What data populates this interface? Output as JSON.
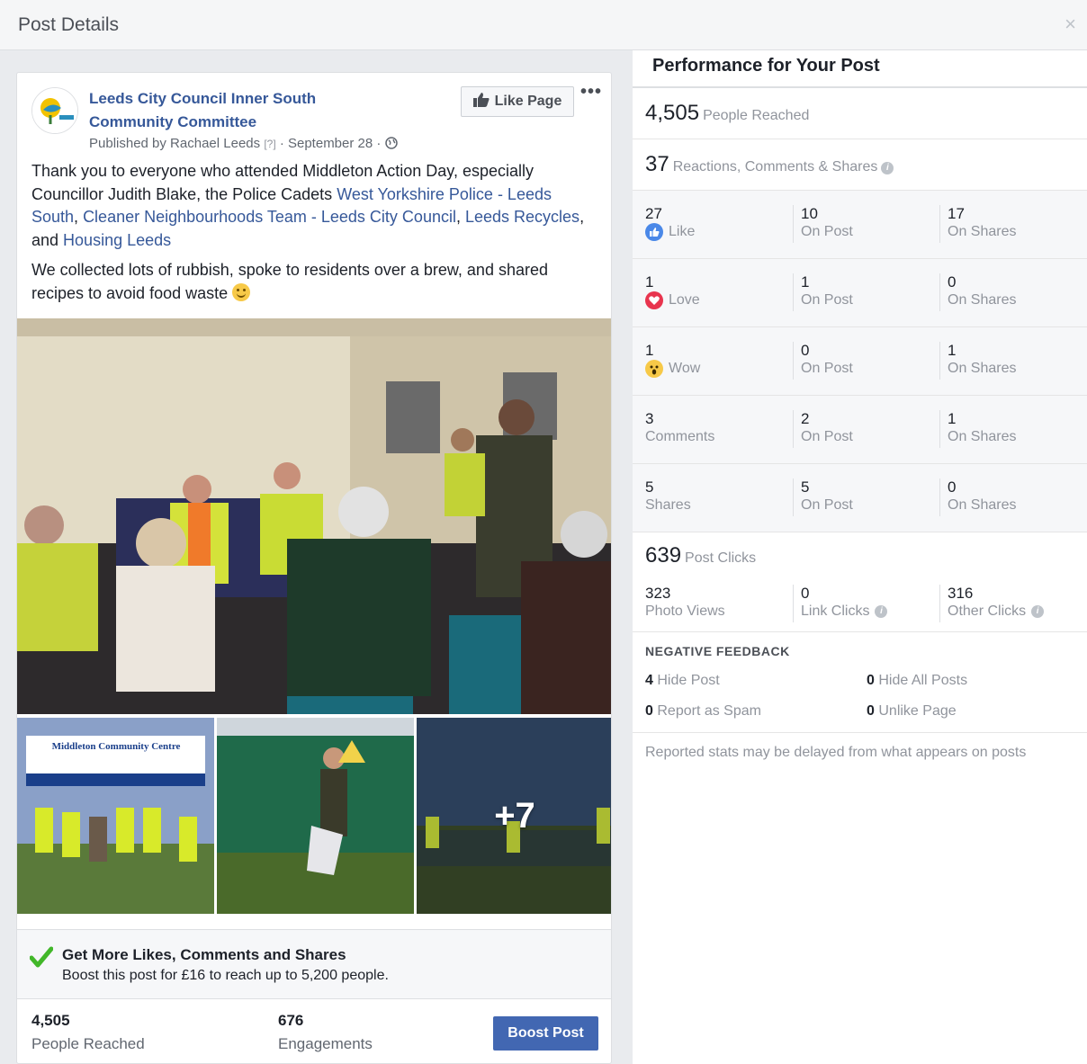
{
  "header": {
    "title": "Post Details",
    "close": "×"
  },
  "post": {
    "page_name": "Leeds City Council Inner South Community Committee",
    "meta_prefix": "Published by Rachael Leeds",
    "meta_q": "[?]",
    "meta_date": "· September 28 ·",
    "like_page": "Like Page",
    "more": "•••",
    "text_parts": {
      "p1": "Thank you to everyone who attended Middleton Action Day, especially Councillor Judith Blake, the Police Cadets ",
      "l1": "West Yorkshire Police - Leeds South",
      "s1": ", ",
      "l2": "Cleaner Neighbourhoods Team - Leeds City Council",
      "s2": ", ",
      "l3": "Leeds Recycles",
      "s3": ", and ",
      "l4": "Housing Leeds"
    },
    "text2": "We collected lots of rubbish, spoke to residents over a brew, and shared recipes to avoid food waste ",
    "thumb_sign": "Middleton Community Centre",
    "more_photos": "+7",
    "boost_title": "Get More Likes, Comments and Shares",
    "boost_sub": "Boost this post for £16 to reach up to 5,200 people.",
    "reached_num": "4,505",
    "reached_lbl": "People Reached",
    "eng_num": "676",
    "eng_lbl": "Engagements",
    "boost_btn": "Boost Post"
  },
  "performance": {
    "title": "Performance for Your Post",
    "reached_num": "4,505",
    "reached_lbl": "People Reached",
    "rcs_num": "37",
    "rcs_lbl": "Reactions, Comments & Shares",
    "info": "i",
    "rows": [
      {
        "n1": "27",
        "l1": "Like",
        "n2": "10",
        "l2": "On Post",
        "n3": "17",
        "l3": "On Shares"
      },
      {
        "n1": "1",
        "l1": "Love",
        "n2": "1",
        "l2": "On Post",
        "n3": "0",
        "l3": "On Shares"
      },
      {
        "n1": "1",
        "l1": "Wow",
        "n2": "0",
        "l2": "On Post",
        "n3": "1",
        "l3": "On Shares"
      },
      {
        "n1": "3",
        "l1": "Comments",
        "n2": "2",
        "l2": "On Post",
        "n3": "1",
        "l3": "On Shares"
      },
      {
        "n1": "5",
        "l1": "Shares",
        "n2": "5",
        "l2": "On Post",
        "n3": "0",
        "l3": "On Shares"
      }
    ],
    "clicks_num": "639",
    "clicks_lbl": "Post Clicks",
    "photo_views_num": "323",
    "photo_views_lbl": "Photo Views",
    "link_clicks_num": "0",
    "link_clicks_lbl": "Link Clicks",
    "other_clicks_num": "316",
    "other_clicks_lbl": "Other Clicks",
    "nf_title": "NEGATIVE FEEDBACK",
    "hide_post_num": "4",
    "hide_post_lbl": "Hide Post",
    "hide_all_num": "0",
    "hide_all_lbl": "Hide All Posts",
    "spam_num": "0",
    "spam_lbl": "Report as Spam",
    "unlike_num": "0",
    "unlike_lbl": "Unlike Page",
    "note": "Reported stats may be delayed from what appears on posts"
  },
  "colors": {
    "link": "#365899",
    "accent": "#4267b2",
    "love": "#e8344e",
    "like": "#4a88e8"
  }
}
